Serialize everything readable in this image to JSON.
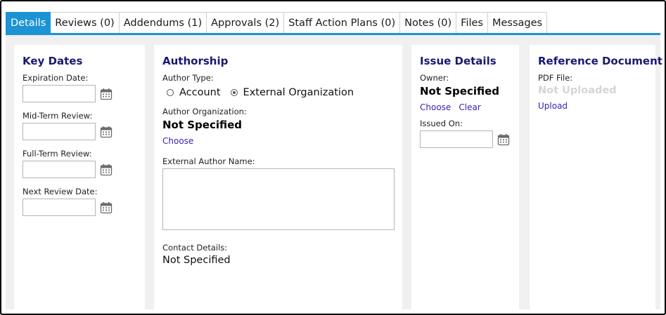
{
  "tabs": [
    {
      "label": "Details",
      "active": true
    },
    {
      "label": "Reviews (0)",
      "active": false
    },
    {
      "label": "Addendums (1)",
      "active": false
    },
    {
      "label": "Approvals (2)",
      "active": false
    },
    {
      "label": "Staff Action Plans (0)",
      "active": false
    },
    {
      "label": "Notes (0)",
      "active": false
    },
    {
      "label": "Files",
      "active": false
    },
    {
      "label": "Messages",
      "active": false
    }
  ],
  "colors": {
    "accent": "#1c93d3",
    "title": "#191970",
    "link": "#3a1fb0"
  },
  "key_dates": {
    "title": "Key Dates",
    "fields": [
      {
        "label": "Expiration Date:",
        "value": ""
      },
      {
        "label": "Mid-Term Review:",
        "value": ""
      },
      {
        "label": "Full-Term Review:",
        "value": ""
      },
      {
        "label": "Next Review Date:",
        "value": ""
      }
    ],
    "icon": "calendar-icon"
  },
  "authorship": {
    "title": "Authorship",
    "author_type_label": "Author Type:",
    "author_type_options": [
      {
        "label": "Account",
        "checked": false
      },
      {
        "label": "External Organization",
        "checked": true
      }
    ],
    "author_org_label": "Author Organization:",
    "author_org_value": "Not Specified",
    "choose_link": "Choose",
    "external_author_label": "External Author Name:",
    "external_author_value": "",
    "contact_label": "Contact Details:",
    "contact_value": "Not Specified"
  },
  "issue_details": {
    "title": "Issue Details",
    "owner_label": "Owner:",
    "owner_value": "Not Specified",
    "choose_link": "Choose",
    "clear_link": "Clear",
    "issued_on_label": "Issued On:",
    "issued_on_value": ""
  },
  "reference_document": {
    "title": "Reference Document",
    "pdf_label": "PDF File:",
    "pdf_value": "Not Uploaded",
    "upload_link": "Upload"
  }
}
